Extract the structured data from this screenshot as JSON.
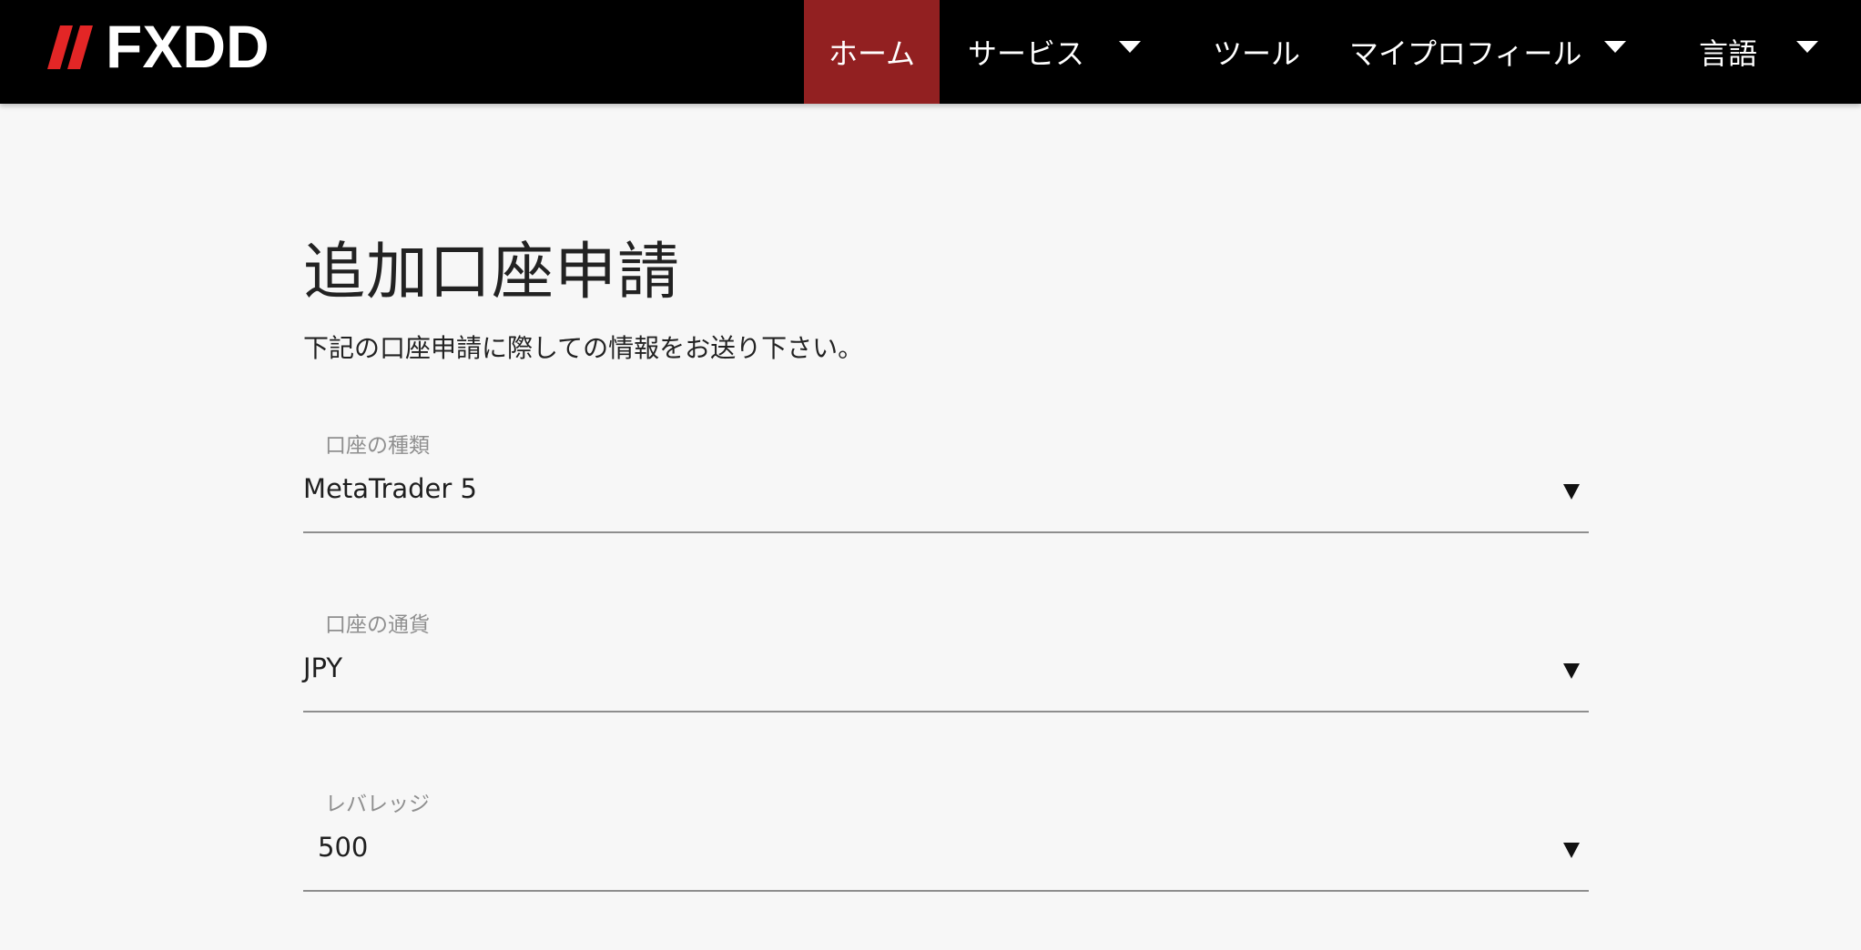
{
  "brand": {
    "name": "FXDD",
    "accent_color": "#e32626",
    "active_nav_color": "#922021"
  },
  "nav": {
    "home": "ホーム",
    "services": "サービス",
    "tools": "ツール",
    "my_profile": "マイプロフィール",
    "language": "言語"
  },
  "page": {
    "title": "追加口座申請",
    "subtitle": "下記の口座申請に際しての情報をお送り下さい。"
  },
  "form": {
    "account_type": {
      "label": "口座の種類",
      "value": "MetaTrader 5"
    },
    "account_currency": {
      "label": "口座の通貨",
      "value": "JPY"
    },
    "leverage": {
      "label": "レバレッジ",
      "value": "500"
    }
  },
  "icons": {
    "dropdown": "caret-down-icon",
    "select": "select-arrow-icon"
  }
}
